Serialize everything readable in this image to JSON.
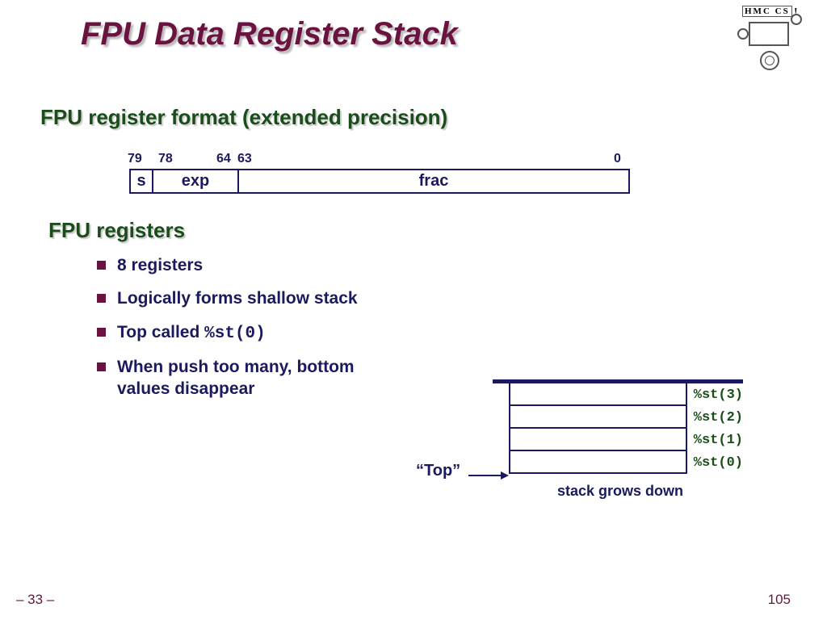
{
  "title": "FPU Data Register Stack",
  "logo_text": "HMC CS",
  "subtitle_format": "FPU register format (extended precision)",
  "bit_labels": {
    "b79": "79",
    "b78": "78",
    "b64": "64",
    "b63": "63",
    "b0": "0"
  },
  "reg_fields": {
    "s": "s",
    "exp": "exp",
    "frac": "frac"
  },
  "subtitle_regs": "FPU registers",
  "bullets": {
    "b1": "8 registers",
    "b2": "Logically forms shallow stack",
    "b3_pre": "Top called ",
    "b3_code": "%st(0)",
    "b4": "When push too many, bottom values disappear"
  },
  "stack": {
    "labels": [
      "%st(3)",
      "%st(2)",
      "%st(1)",
      "%st(0)"
    ],
    "grow": "stack grows down",
    "top": "“Top”"
  },
  "page_left": "– 33 –",
  "page_right": "105"
}
